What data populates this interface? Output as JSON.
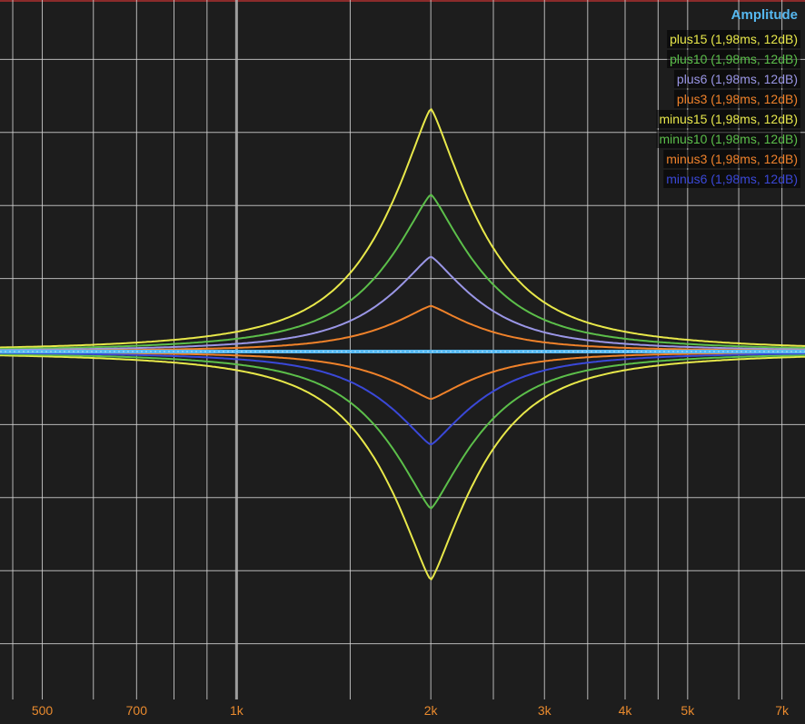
{
  "chart_data": {
    "type": "line",
    "title": "",
    "xlabel": "",
    "ylabel": "",
    "x_scale": "log",
    "xlim": [
      430,
      7600
    ],
    "ylim": [
      -16,
      16
    ],
    "grid": true,
    "x_ticks": [
      {
        "value": 500,
        "label": "500"
      },
      {
        "value": 700,
        "label": "700"
      },
      {
        "value": 1000,
        "label": "1k"
      },
      {
        "value": 2000,
        "label": "2k"
      },
      {
        "value": 3000,
        "label": "3k"
      },
      {
        "value": 4000,
        "label": "4k"
      },
      {
        "value": 5000,
        "label": "5k"
      },
      {
        "value": 7000,
        "label": "7k"
      }
    ],
    "minor_x_gridlines": [
      450,
      600,
      800,
      900,
      1500,
      2500,
      3500,
      4500,
      6000
    ],
    "y_gridlines": [
      -16,
      -12,
      -8,
      -4,
      4,
      8,
      12,
      16
    ],
    "legend": {
      "title": "Amplitude",
      "placement": "top-right",
      "title_color": "#56b8f0"
    },
    "center_frequency": 2000,
    "series": [
      {
        "name": "plus15 (1,98ms, 12dB)",
        "color": "#e8e84a",
        "gain_db": 13.3
      },
      {
        "name": "plus10 (1,98ms, 12dB)",
        "color": "#5cbf4a",
        "gain_db": 8.6
      },
      {
        "name": "plus6 (1,98ms, 12dB)",
        "color": "#9a96e6",
        "gain_db": 5.2
      },
      {
        "name": "plus3 (1,98ms, 12dB)",
        "color": "#f0822a",
        "gain_db": 2.5
      },
      {
        "name": "minus15 (1,98ms, 12dB)",
        "color": "#e8e84a",
        "gain_db": -12.5
      },
      {
        "name": "minus10 (1,98ms, 12dB)",
        "color": "#5cbf4a",
        "gain_db": -8.6
      },
      {
        "name": "minus3 (1,98ms, 12dB)",
        "color": "#f0822a",
        "gain_db": -2.6
      },
      {
        "name": "minus6 (1,98ms, 12dB)",
        "color": "#3a48d8",
        "gain_db": -5.1
      }
    ],
    "baseline": {
      "color": "#56b8f0",
      "value_db": 0
    }
  },
  "colors": {
    "background": "#1d1d1d",
    "grid": "#d2d2d2",
    "grid_major": "#b4b4b4",
    "tick_label": "#e98a2e",
    "top_rule": "#b03030"
  }
}
